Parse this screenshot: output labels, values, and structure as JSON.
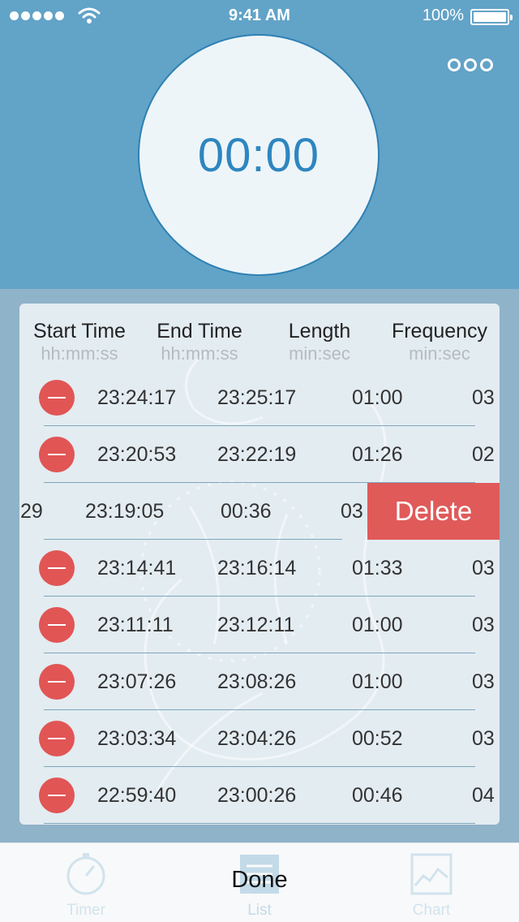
{
  "status_bar": {
    "time": "9:41 AM",
    "battery": "100%"
  },
  "timer": {
    "value": "00:00"
  },
  "table": {
    "headers": [
      {
        "title": "Start Time",
        "unit": "hh:mm:ss"
      },
      {
        "title": "End Time",
        "unit": "hh:mm:ss"
      },
      {
        "title": "Length",
        "unit": "min:sec"
      },
      {
        "title": "Frequency",
        "unit": "min:sec"
      }
    ],
    "rows": [
      {
        "start": "23:24:17",
        "end": "23:25:17",
        "length": "01:00",
        "frequency": "03"
      },
      {
        "start": "23:20:53",
        "end": "23:22:19",
        "length": "01:26",
        "frequency": "02"
      },
      {
        "start": ":29",
        "end": "23:19:05",
        "length": "00:36",
        "frequency": "03"
      },
      {
        "start": "23:14:41",
        "end": "23:16:14",
        "length": "01:33",
        "frequency": "03"
      },
      {
        "start": "23:11:11",
        "end": "23:12:11",
        "length": "01:00",
        "frequency": "03"
      },
      {
        "start": "23:07:26",
        "end": "23:08:26",
        "length": "01:00",
        "frequency": "03"
      },
      {
        "start": "23:03:34",
        "end": "23:04:26",
        "length": "00:52",
        "frequency": "03"
      },
      {
        "start": "22:59:40",
        "end": "23:00:26",
        "length": "00:46",
        "frequency": "04"
      }
    ],
    "delete_label": "Delete"
  },
  "tabbar": {
    "tabs": [
      {
        "label": "Timer",
        "icon": "stopwatch-icon"
      },
      {
        "label": "List",
        "icon": "list-icon"
      },
      {
        "label": "Chart",
        "icon": "chart-icon"
      }
    ],
    "done_label": "Done"
  },
  "colors": {
    "header_bg": "#62a3c8",
    "accent": "#2e86bf",
    "delete": "#e05a5a"
  }
}
